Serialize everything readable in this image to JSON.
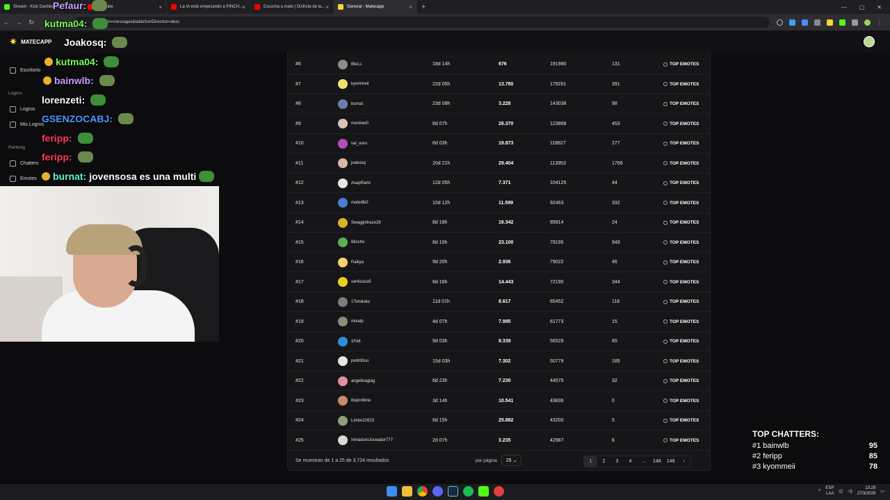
{
  "browser": {
    "tabs": [
      {
        "title": "Stream - Kick Dashboard",
        "color": "#53fc18"
      },
      {
        "title": "YouTube",
        "color": "#ff0000"
      },
      {
        "title": "La IA está empezando a PINCH...",
        "color": "#ff0000"
      },
      {
        "title": "Escucha a mate | Disfruta de la...",
        "color": "#ff0000"
      },
      {
        "title": "General - Matecapp",
        "color": "#ffd43b",
        "active": true
      }
    ],
    "url": "...nn=messages&tableSortDirection=desc"
  },
  "app": {
    "brand": "MATECAPP"
  },
  "sidebar": {
    "items": [
      {
        "label": "Escritorio",
        "kind": "item"
      },
      {
        "label": "Logros",
        "kind": "section"
      },
      {
        "label": "Logros",
        "kind": "item"
      },
      {
        "label": "Mis Logros",
        "kind": "item"
      },
      {
        "label": "Ranking",
        "kind": "section"
      },
      {
        "label": "Chatters",
        "kind": "item"
      },
      {
        "label": "Emotes",
        "kind": "item"
      }
    ]
  },
  "chat_overlay": [
    {
      "user": "Pefaur:",
      "color": "#c9a0ff",
      "msg": ""
    },
    {
      "user": "kutma04:",
      "color": "#7bff5a",
      "msg": ""
    },
    {
      "user": "Joakosq:",
      "color": "#ffffff",
      "msg": ""
    },
    {
      "user": "kutma04:",
      "color": "#7bff5a",
      "msg": ""
    },
    {
      "user": "bainwlb:",
      "color": "#c9a0ff",
      "msg": ""
    },
    {
      "user": "lorenzeti:",
      "color": "#ffffff",
      "msg": ""
    },
    {
      "user": "GSENZOCABJ:",
      "color": "#4d9bff",
      "msg": ""
    },
    {
      "user": "feripp:",
      "color": "#ff3b5c",
      "msg": ""
    },
    {
      "user": "feripp:",
      "color": "#ff3b5c",
      "msg": ""
    },
    {
      "user": "burnat:",
      "color": "#5affd4",
      "msg": "jovensosa es una multi"
    }
  ],
  "table": {
    "rows": [
      {
        "rank": "#6",
        "user": "lBeLs",
        "time": "18d 14h",
        "messages": "676",
        "points": "191980",
        "emotes": "131",
        "action": "TOP EMOTES",
        "av": "#8c8c8c"
      },
      {
        "rank": "#7",
        "user": "kyommeii",
        "time": "22d 05h",
        "messages": "13.780",
        "points": "179261",
        "emotes": "391",
        "action": "TOP EMOTES",
        "av": "#f1e36a"
      },
      {
        "rank": "#8",
        "user": "burnat",
        "time": "23d 08h",
        "messages": "3.228",
        "points": "143038",
        "emotes": "98",
        "action": "TOP EMOTES",
        "av": "#6a7fa8"
      },
      {
        "rank": "#9",
        "user": "monkiwi0",
        "time": "8d 07h",
        "messages": "26.370",
        "points": "123868",
        "emotes": "453",
        "action": "TOP EMOTES",
        "av": "#d7c4b5"
      },
      {
        "rank": "#10",
        "user": "val_oren",
        "time": "6d 03h",
        "messages": "19.873",
        "points": "118827",
        "emotes": "277",
        "action": "TOP EMOTES",
        "av": "#b04fbd"
      },
      {
        "rank": "#11",
        "user": "joakosq",
        "time": "20d 21h",
        "messages": "29.404",
        "points": "113953",
        "emotes": "1766",
        "action": "TOP EMOTES",
        "av": "#d9b7a8"
      },
      {
        "rank": "#12",
        "user": "AsapRami",
        "time": "12d 05h",
        "messages": "7.371",
        "points": "104125",
        "emotes": "44",
        "action": "TOP EMOTES",
        "av": "#e6e6e6"
      },
      {
        "rank": "#13",
        "user": "matedbi2",
        "time": "10d 12h",
        "messages": "11.599",
        "points": "92463",
        "emotes": "332",
        "action": "TOP EMOTES",
        "av": "#4a7fd1"
      },
      {
        "rank": "#14",
        "user": "Swagginhaze28",
        "time": "8d 18h",
        "messages": "16.342",
        "points": "85814",
        "emotes": "24",
        "action": "TOP EMOTES",
        "av": "#d8b22a"
      },
      {
        "rank": "#15",
        "user": "6tincho",
        "time": "8d 10h",
        "messages": "23.100",
        "points": "79195",
        "emotes": "949",
        "action": "TOP EMOTES",
        "av": "#5fae4f"
      },
      {
        "rank": "#16",
        "user": "Paikya",
        "time": "9d 20h",
        "messages": "2.936",
        "points": "79022",
        "emotes": "46",
        "action": "TOP EMOTES",
        "av": "#f3d36a"
      },
      {
        "rank": "#17",
        "user": "santizaza5",
        "time": "6d 16h",
        "messages": "14.443",
        "points": "72190",
        "emotes": "344",
        "action": "TOP EMOTES",
        "av": "#e7d21f"
      },
      {
        "rank": "#18",
        "user": "1Tomiioko",
        "time": "11d 01h",
        "messages": "8.617",
        "points": "65452",
        "emotes": "118",
        "action": "TOP EMOTES",
        "av": "#7d7d7d"
      },
      {
        "rank": "#19",
        "user": "mixatp",
        "time": "4d 07h",
        "messages": "7.995",
        "points": "61773",
        "emotes": "15",
        "action": "TOP EMOTES",
        "av": "#8f8a79"
      },
      {
        "rank": "#20",
        "user": "1Fett",
        "time": "9d 03h",
        "messages": "9.339",
        "points": "56529",
        "emotes": "65",
        "action": "TOP EMOTES",
        "av": "#2e8fd6"
      },
      {
        "rank": "#21",
        "user": "pedrit0uu",
        "time": "15d 03h",
        "messages": "7.302",
        "points": "50779",
        "emotes": "185",
        "action": "TOP EMOTES",
        "av": "#e6e6e6"
      },
      {
        "rank": "#22",
        "user": "angelinagiag",
        "time": "6d 23h",
        "messages": "7.230",
        "points": "44575",
        "emotes": "32",
        "action": "TOP EMOTES",
        "av": "#e08fa3"
      },
      {
        "rank": "#23",
        "user": "ibuprofeno",
        "time": "3d 14h",
        "messages": "10.541",
        "points": "43836",
        "emotes": "0",
        "action": "TOP EMOTES",
        "av": "#c88a6a"
      },
      {
        "rank": "#24",
        "user": "Limbo22623",
        "time": "6d 15h",
        "messages": "25.882",
        "points": "43200",
        "emotes": "5",
        "action": "TOP EMOTES",
        "av": "#8da07a"
      },
      {
        "rank": "#25",
        "user": "InmaduroJoseador777",
        "time": "2d 07h",
        "messages": "3.235",
        "points": "42987",
        "emotes": "6",
        "action": "TOP EMOTES",
        "av": "#d9d9d9"
      }
    ],
    "results_text": "Se muestran de 1 a 25 de 3,724 resultados",
    "per_page_label": "por página",
    "per_page_value": "25",
    "pages": [
      "1",
      "2",
      "3",
      "4",
      "...",
      "148",
      "149",
      "›"
    ],
    "current_page": "1"
  },
  "top_chatters": {
    "title": "TOP CHATTERS:",
    "rows": [
      {
        "name": "#1 bainwlb",
        "count": "95"
      },
      {
        "name": "#2 feripp",
        "count": "85"
      },
      {
        "name": "#3 kyommeii",
        "count": "78"
      }
    ]
  },
  "taskbar": {
    "lang": "ESP",
    "lang2": "LAA",
    "time": "13:29",
    "date": "27/3/2026"
  }
}
